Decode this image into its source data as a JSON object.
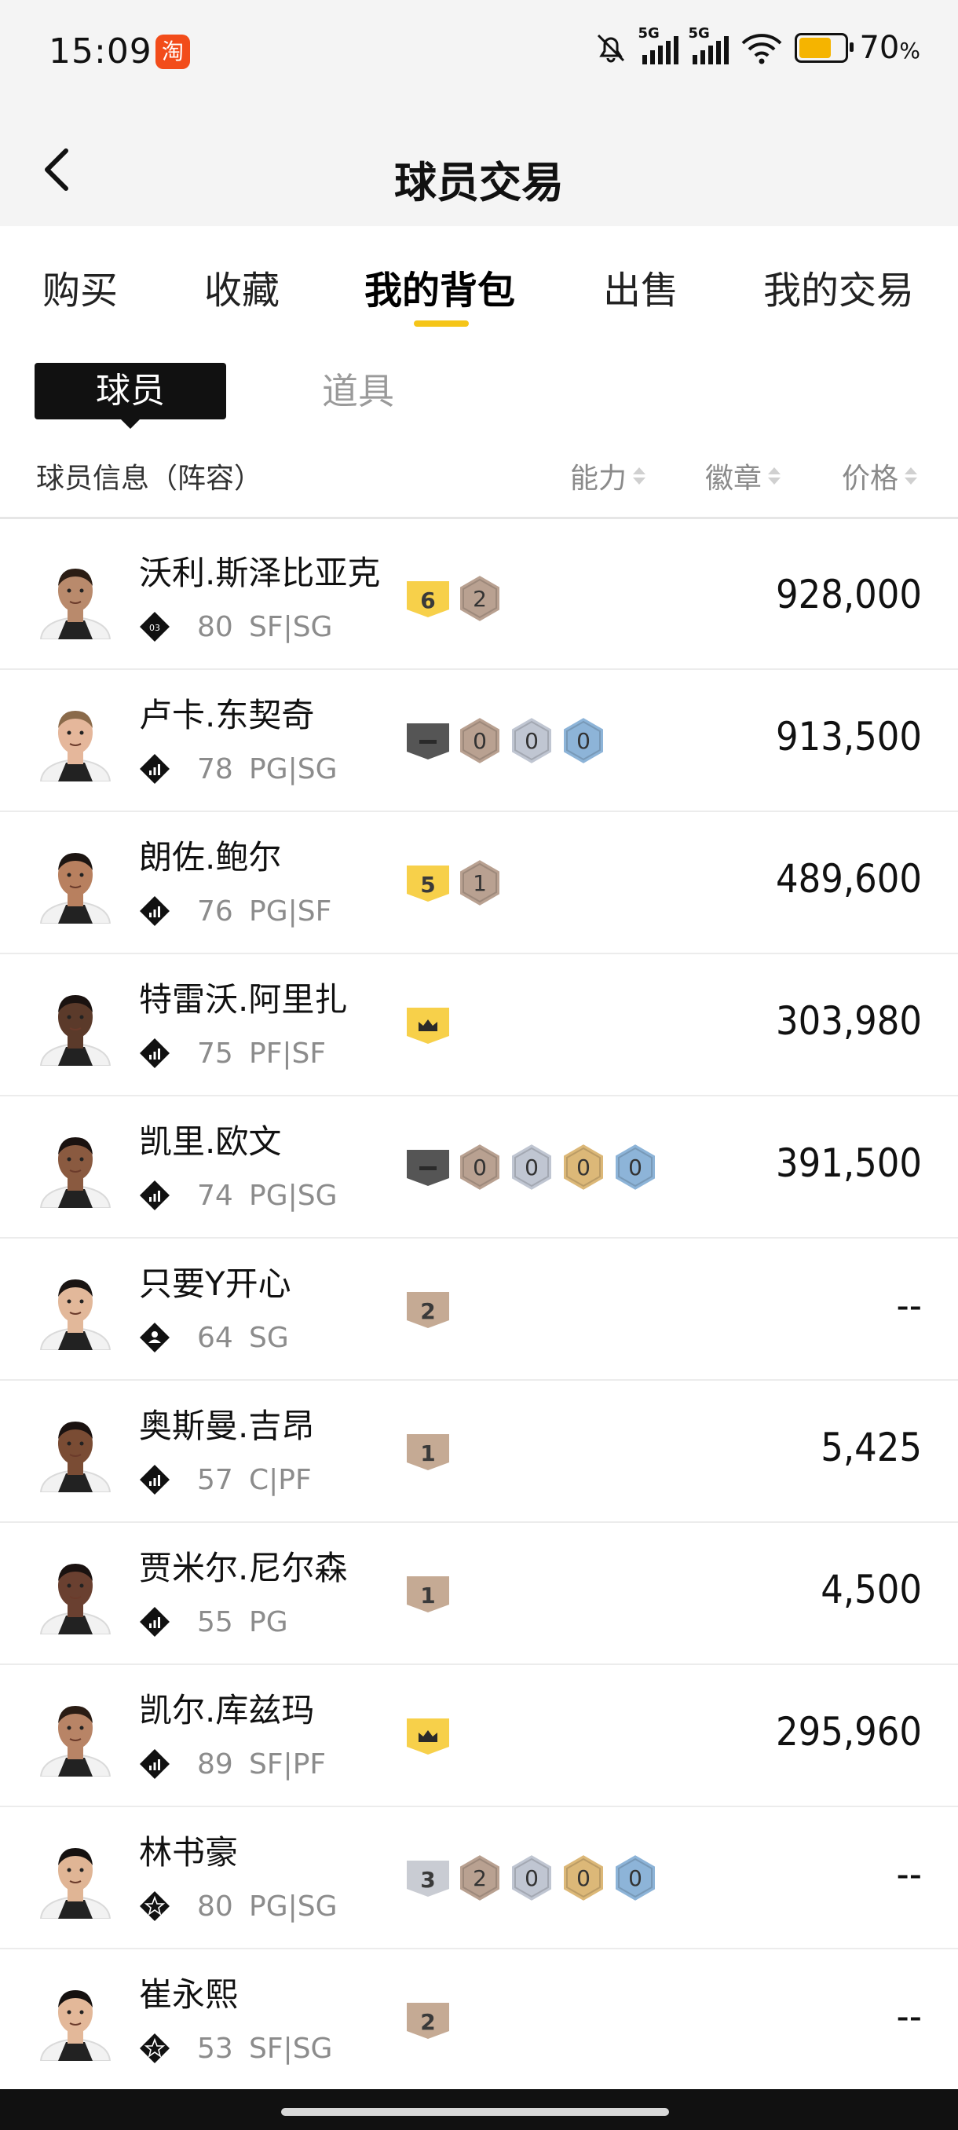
{
  "status_bar": {
    "time": "15:09",
    "app_icon_text": "淘",
    "signal_1_label": "5G",
    "signal_2_label": "5G",
    "battery_level": 0.7,
    "battery_pct": "70",
    "battery_unit": "%"
  },
  "header": {
    "title": "球员交易"
  },
  "tabs": [
    {
      "label": "购买"
    },
    {
      "label": "收藏"
    },
    {
      "label": "我的背包",
      "active": true
    },
    {
      "label": "出售"
    },
    {
      "label": "我的交易"
    }
  ],
  "subtabs": {
    "player": "球员",
    "item": "道具"
  },
  "columns": {
    "info": "球员信息（阵容）",
    "ability": "能力",
    "badge": "徽章",
    "price": "价格"
  },
  "colors": {
    "accent": "#f5c518",
    "gold_tag": "#f7d04a",
    "bronze_tag": "#c5aa94",
    "dark_tag": "#555555",
    "silver_tag": "#c9ccd3",
    "hex_bronze": "#b9a191",
    "hex_silver": "#c0c6d2",
    "hex_gold": "#dcb878",
    "hex_blue": "#8db4d8"
  },
  "players": [
    {
      "name": "沃利.斯泽比亚克",
      "rank": "03",
      "rank_icon": "diamond-rank-icon",
      "ovr": "80",
      "pos": "SF|SG",
      "tag": {
        "type": "gold",
        "text": "6"
      },
      "hexes": [
        {
          "c": "bronze",
          "t": "2"
        }
      ],
      "price": "928,000",
      "skin": "#b98a6c",
      "hair": "#2b1d14"
    },
    {
      "name": "卢卡.东契奇",
      "rank": "",
      "rank_icon": "signal-rank-icon",
      "ovr": "78",
      "pos": "PG|SG",
      "tag": {
        "type": "dark",
        "text": "—"
      },
      "hexes": [
        {
          "c": "bronze",
          "t": "0"
        },
        {
          "c": "silver",
          "t": "0"
        },
        {
          "c": "blue",
          "t": "0"
        }
      ],
      "price": "913,500",
      "skin": "#e5b79b",
      "hair": "#8a6a4a"
    },
    {
      "name": "朗佐.鲍尔",
      "rank": "",
      "rank_icon": "signal-rank-icon",
      "ovr": "76",
      "pos": "PG|SF",
      "tag": {
        "type": "gold",
        "text": "5"
      },
      "hexes": [
        {
          "c": "bronze",
          "t": "1"
        }
      ],
      "price": "489,600",
      "skin": "#b8805f",
      "hair": "#1c1512"
    },
    {
      "name": "特雷沃.阿里扎",
      "rank": "",
      "rank_icon": "signal-rank-icon",
      "ovr": "75",
      "pos": "PF|SF",
      "tag": {
        "type": "gold",
        "text": "♛"
      },
      "hexes": [],
      "price": "303,980",
      "skin": "#5b3a2a",
      "hair": "#1a1210"
    },
    {
      "name": "凯里.欧文",
      "rank": "",
      "rank_icon": "signal-rank-icon",
      "ovr": "74",
      "pos": "PG|SG",
      "tag": {
        "type": "dark",
        "text": "—"
      },
      "hexes": [
        {
          "c": "bronze",
          "t": "0"
        },
        {
          "c": "silver",
          "t": "0"
        },
        {
          "c": "gold",
          "t": "0"
        },
        {
          "c": "blue",
          "t": "0"
        }
      ],
      "price": "391,500",
      "skin": "#8a5a40",
      "hair": "#1a1210"
    },
    {
      "name": "只要Y开心",
      "rank": "",
      "rank_icon": "person-rank-icon",
      "ovr": "64",
      "pos": "SG",
      "tag": {
        "type": "bronze",
        "text": "2"
      },
      "hexes": [],
      "price": "--",
      "skin": "#e2b89a",
      "hair": "#1a1412"
    },
    {
      "name": "奥斯曼.吉昂",
      "rank": "",
      "rank_icon": "signal-rank-icon",
      "ovr": "57",
      "pos": "C|PF",
      "tag": {
        "type": "bronze",
        "text": "1"
      },
      "hexes": [],
      "price": "5,425",
      "skin": "#7a4c34",
      "hair": "#1a1210"
    },
    {
      "name": "贾米尔.尼尔森",
      "rank": "",
      "rank_icon": "signal-rank-icon",
      "ovr": "55",
      "pos": "PG",
      "tag": {
        "type": "bronze",
        "text": "1"
      },
      "hexes": [],
      "price": "4,500",
      "skin": "#6a4030",
      "hair": "#1a1210"
    },
    {
      "name": "凯尔.库兹玛",
      "rank": "",
      "rank_icon": "signal-rank-icon",
      "ovr": "89",
      "pos": "SF|PF",
      "tag": {
        "type": "gold",
        "text": "♛"
      },
      "hexes": [],
      "price": "295,960",
      "skin": "#b88466",
      "hair": "#2a1c14"
    },
    {
      "name": "林书豪",
      "rank": "",
      "rank_icon": "star-rank-icon",
      "ovr": "80",
      "pos": "PG|SG",
      "tag": {
        "type": "silver",
        "text": "3"
      },
      "hexes": [
        {
          "c": "bronze",
          "t": "2"
        },
        {
          "c": "silver",
          "t": "0"
        },
        {
          "c": "gold",
          "t": "0"
        },
        {
          "c": "blue",
          "t": "0"
        }
      ],
      "price": "--",
      "skin": "#e0b595",
      "hair": "#151110"
    },
    {
      "name": "崔永熙",
      "rank": "",
      "rank_icon": "star-rank-icon",
      "ovr": "53",
      "pos": "SF|SG",
      "tag": {
        "type": "bronze",
        "text": "2"
      },
      "hexes": [],
      "price": "--",
      "skin": "#e3b899",
      "hair": "#151110"
    }
  ]
}
